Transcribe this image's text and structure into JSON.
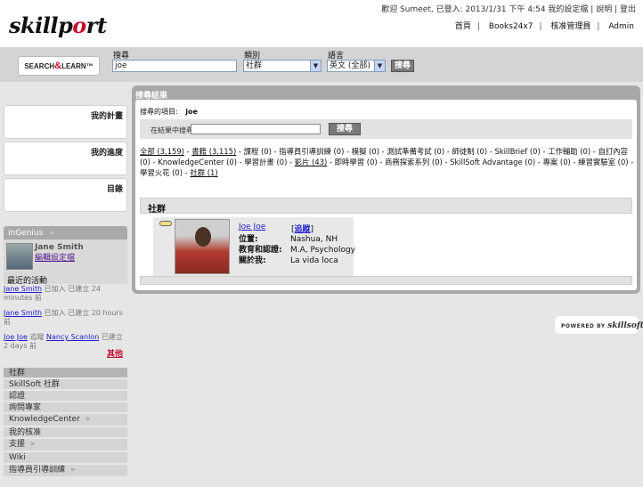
{
  "header": {
    "logo_text": "skillport",
    "welcome": "歡迎 Sumeet, 已登入: 2013/1/31 下午 4:54",
    "top_links": [
      "我的設定檔",
      "說明",
      "登出"
    ],
    "nav": [
      "首頁",
      "Books24x7",
      "核准管理員",
      "Admin"
    ]
  },
  "search": {
    "logo": "SEARCH & LEARN",
    "query_label": "搜尋",
    "query_value": "joe",
    "category_label": "類別",
    "category_value": "社群",
    "language_label": "語言",
    "language_value": "英文 (全部)",
    "submit": "搜尋"
  },
  "sidebar": {
    "boxes": [
      "我的計畫",
      "我的進度",
      "目錄"
    ],
    "genius_title": "inGenius",
    "profile_name": "Jane Smith",
    "profile_link": "編輯設定檔",
    "recent_title": "最近的活動",
    "recent": [
      {
        "user": "Jane Smith",
        "text": "已加入 已建立 24 minutes 前"
      },
      {
        "user": "Jane Smith",
        "text": "已加入 已建立 20 hours 前"
      },
      {
        "user": "Joe Joe",
        "mid": "追蹤",
        "user2": "Nancy Scanlon",
        "text": "已建立 2 days 前"
      }
    ],
    "more": "其他",
    "menu": [
      "社群",
      "SkillSoft 社群",
      "認證",
      "詢問專家",
      "KnowledgeCenter",
      "我的核准",
      "支援",
      "Wiki",
      "指導員引導訓練"
    ]
  },
  "results": {
    "title": "搜尋結果",
    "term_label": "搜尋的項目:",
    "term_value": "joe",
    "refine_label": "在結果中搜尋",
    "refine_button": "搜尋",
    "categories_text": [
      {
        "t": "全部 (3,159)",
        "u": true
      },
      {
        "t": " - "
      },
      {
        "t": "書籍 (3,115)",
        "u": true
      },
      {
        "t": " - 課程 (0) - 指導員引導訓練 (0) - 模擬 (0) - 測試準備考試 (0) - 師徒制 (0) - SkillBrief (0) - 工作輔助 (0) - 自訂內容 (0) - KnowledgeCenter (0) - 學習計畫 (0) - "
      },
      {
        "t": "影片 (43)",
        "u": true
      },
      {
        "t": " - 即時學習 (0) - 商務探索系列 (0) - SkillSoft Advantage (0) - 專案 (0) - 練習實驗室 (0) - 學習火花 (0) - "
      },
      {
        "t": "社群 (1)",
        "u": true
      }
    ],
    "section": "社群",
    "person": {
      "name": "Joe Joe",
      "follow": "追蹤",
      "rows": [
        {
          "k": "位置:",
          "v": "Nashua, NH"
        },
        {
          "k": "教育和認證:",
          "v": "M.A, Psychology"
        },
        {
          "k": "關於我:",
          "v": "La vida loca"
        }
      ]
    }
  },
  "footer": {
    "powered": "POWERED BY",
    "brand": "skillsoft"
  }
}
